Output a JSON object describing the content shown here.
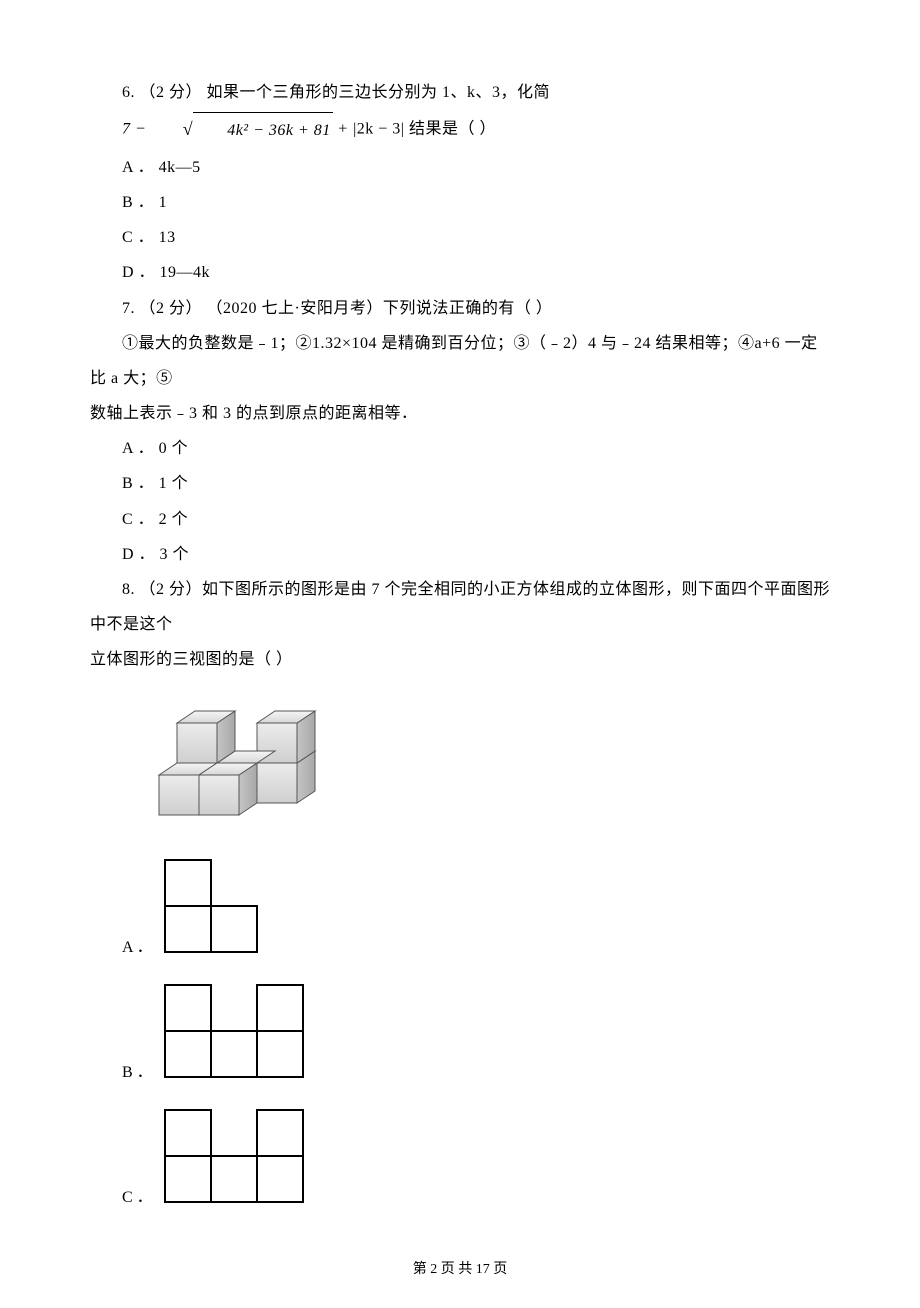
{
  "q6": {
    "prefix": "6. （2 分）  如果一个三角形的三边长分别为 1、k、3，化简 ",
    "formula_lead": "7 − ",
    "formula_rad": "4k² − 36k + 81",
    "formula_plus": " + ",
    "formula_abs": "|2k − 3|",
    "suffix": " 结果是（      ）",
    "A": "A ． 4k—5",
    "B": "B ． 1",
    "C": "C ． 13",
    "D": "D ． 19—4k"
  },
  "q7": {
    "stem": "7. （2 分） （2020 七上·安阳月考）下列说法正确的有（      ）",
    "body1": "①最大的负整数是﹣1；②1.32×104 是精确到百分位；③（﹣2）4 与﹣24 结果相等；④a+6 一定比 a 大；⑤",
    "body2": "数轴上表示﹣3 和 3 的点到原点的距离相等．",
    "A": "A ． 0 个",
    "B": "B ． 1 个",
    "C": "C ． 2 个",
    "D": "D ． 3 个"
  },
  "q8": {
    "stem1": "8. （2 分）如下图所示的图形是由 7 个完全相同的小正方体组成的立体图形，则下面四个平面图形中不是这个",
    "stem2": "立体图形的三视图的是（      ）",
    "A": "A ．",
    "B": "B ．",
    "C": "C ．"
  },
  "footer": "第 2 页 共 17 页"
}
